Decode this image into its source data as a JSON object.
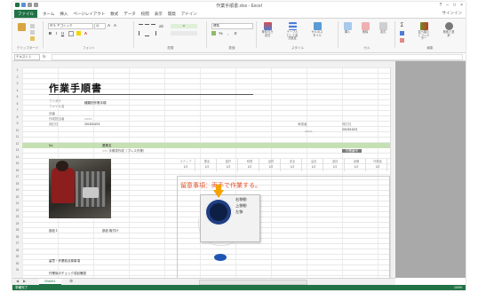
{
  "window": {
    "title": "作業手順書.xlsx - Excel",
    "controls": [
      "?",
      "–",
      "□",
      "×"
    ]
  },
  "menu": {
    "file": "ファイル",
    "items": [
      "ホーム",
      "挿入",
      "ページレイアウト",
      "数式",
      "データ",
      "校閲",
      "表示",
      "開発",
      "アドイン"
    ],
    "signin": "サインイン"
  },
  "ribbon": {
    "font_name": "ＭＳ Ｐゴシック",
    "font_size": "11",
    "number_format": "標準",
    "groups": [
      "クリップボード",
      "フォント",
      "配置",
      "数値",
      "スタイル",
      "セル",
      "編集"
    ],
    "buttons": [
      "条件付き書式",
      "テーブルとして書式設定",
      "セルのスタイル",
      "挿入",
      "削除",
      "書式",
      "並べ替えとフィルター",
      "検索と選択"
    ]
  },
  "formula_bar": {
    "name_box": "テキスト 1",
    "fx": "fx"
  },
  "sheet": {
    "title": "作業手順書",
    "fields": [
      {
        "label": "フリガナ",
        "value": ""
      },
      {
        "label": "ファイル名",
        "value": "種類別作業手順"
      },
      {
        "label": "品番",
        "value": ""
      },
      {
        "label": "作成担当者",
        "value": "○○○○"
      },
      {
        "label": "改訂日",
        "value": "2015/10/21"
      }
    ],
    "approval_label": "承認者",
    "approval_value": "○○○○",
    "date_label": "改訂日",
    "date_value": "2015/10/21",
    "header_row": {
      "no": "No.",
      "name": "要素名",
      "code": "作業番号"
    },
    "sub_row": "○○○ 手順書作成（プレス作業）",
    "steps": [
      {
        "k": "ステップ",
        "v": "1/2"
      },
      {
        "k": "要素",
        "v": "1/2"
      },
      {
        "k": "動作",
        "v": "1/2"
      },
      {
        "k": "時間",
        "v": "1/2"
      },
      {
        "k": "品質",
        "v": "1/2"
      },
      {
        "k": "安全",
        "v": "1/2"
      },
      {
        "k": "治具",
        "v": "1/2"
      },
      {
        "k": "道具",
        "v": "1/2"
      },
      {
        "k": "設備",
        "v": "1/2"
      },
      {
        "k": "作業者",
        "v": "1/2"
      }
    ],
    "note": "留意事項：両手で作業する。",
    "popup_menu": [
      "右移動",
      "上移動",
      "左移"
    ],
    "row_notes": [
      {
        "label": "部品１",
        "value": "部品 取付け"
      },
      {
        "label": "留意・作業前点検事項",
        "value": ""
      },
      {
        "label": "作業後のチェック項目確認",
        "value": ""
      }
    ]
  },
  "tabs": {
    "sheet_name": "Sheet1",
    "add": "⊕"
  },
  "status": {
    "left": "準備完了",
    "zoom": "100%"
  },
  "row_numbers": [
    "1",
    "2",
    "3",
    "4",
    "5",
    "6",
    "7",
    "8",
    "9",
    "10",
    "11",
    "12",
    "13",
    "14",
    "15",
    "16",
    "17",
    "18",
    "19",
    "20",
    "21",
    "22",
    "23",
    "24",
    "25",
    "26",
    "27",
    "28",
    "29",
    "30",
    "31"
  ]
}
